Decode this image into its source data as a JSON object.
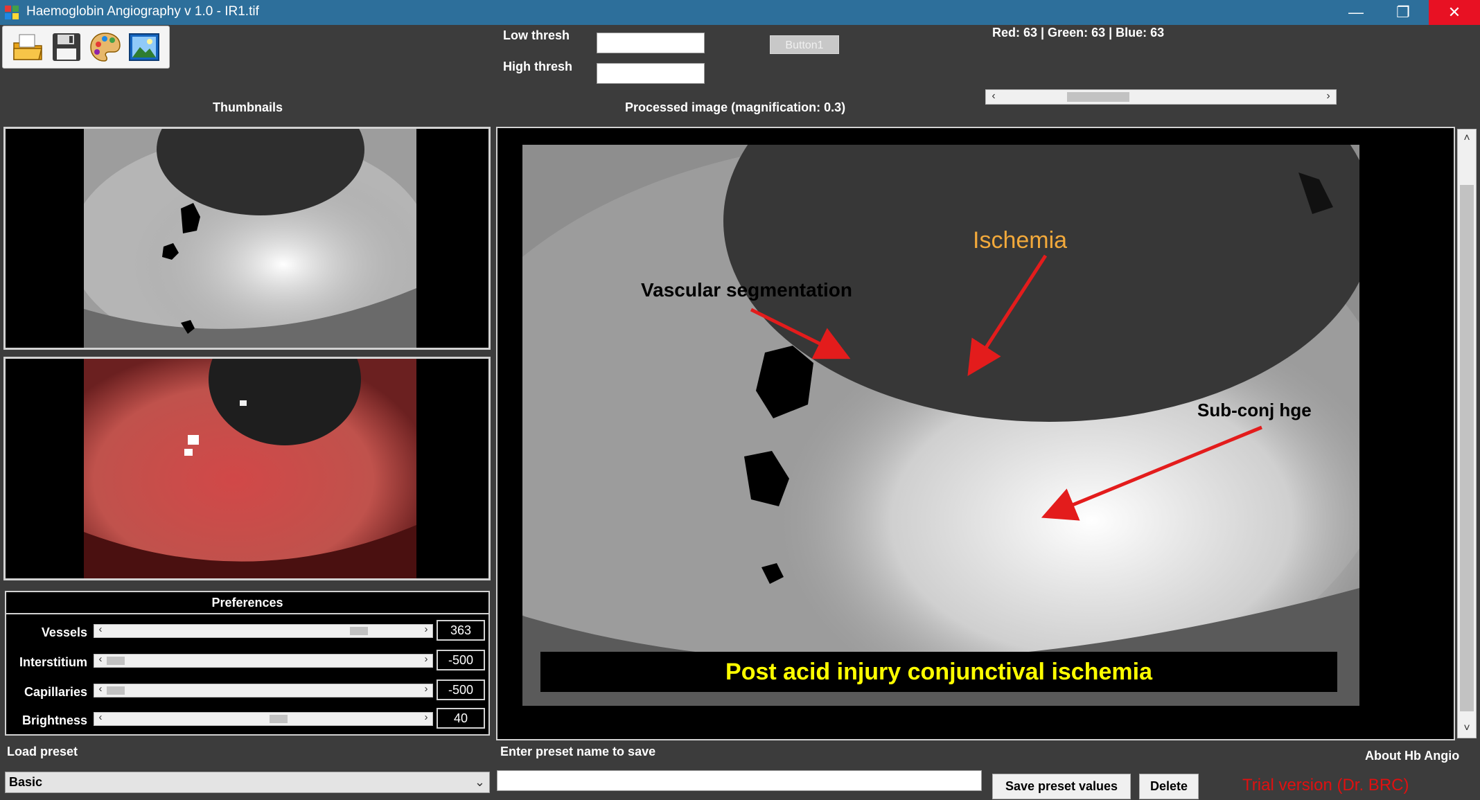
{
  "window": {
    "title": "Haemoglobin Angiography v 1.0 - IR1.tif",
    "minimize_icon": "minimize-icon",
    "maximize_icon": "restore-icon",
    "close_icon": "close-icon"
  },
  "toolbar": {
    "items": [
      "open-folder-icon",
      "save-disk-icon",
      "palette-icon",
      "picture-icon"
    ]
  },
  "thresholds": {
    "low_label": "Low thresh",
    "high_label": "High thresh",
    "low_value": "",
    "high_value": ""
  },
  "button1_label": "Button1",
  "rgb_readout": "Red: 63 | Green: 63 | Blue: 63",
  "thumbnails_label": "Thumbnails",
  "processed_label": "Processed image (magnification: 0.3)",
  "annotations": {
    "ischemia": "Ischemia",
    "vascular": "Vascular segmentation",
    "subconj": "Sub-conj hge",
    "caption": "Post acid injury conjunctival ischemia"
  },
  "preferences": {
    "title": "Preferences",
    "rows": [
      {
        "label": "Vessels",
        "value": "363",
        "level": 0.82
      },
      {
        "label": "Interstitium",
        "value": "-500",
        "level": 0.0
      },
      {
        "label": "Capillaries",
        "value": "-500",
        "level": 0.0
      },
      {
        "label": "Brightness",
        "value": "40",
        "level": 0.55
      }
    ]
  },
  "bottom": {
    "load_preset_label": "Load preset",
    "preset_selected": "Basic",
    "preset_name_label": "Enter preset name to save",
    "preset_name_value": "",
    "save_button": "Save preset values",
    "delete_button": "Delete",
    "about_link": "About Hb Angio",
    "trial_text": "Trial version (Dr. BRC)"
  },
  "colors": {
    "titlebar": "#2d6f9b",
    "background": "#3c3c3c",
    "ischemia_text": "#f2a93b",
    "arrow": "#e31c1c",
    "caption_text": "#ffff00",
    "trial_text": "#e01010"
  }
}
